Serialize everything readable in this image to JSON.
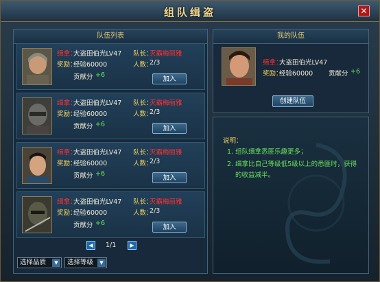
{
  "window": {
    "title": "组队缉盗",
    "close_label": "✕"
  },
  "team_list": {
    "header": "队伍列表",
    "rows": [
      {
        "wanted_label": "缉拿：",
        "wanted": "大盗田伯光LV47",
        "leader_label": "队长：",
        "leader": "灭霸梅丽雅",
        "reward_label": "奖励：",
        "reward": "经验60000",
        "members_label": "人数：",
        "members": "2/3",
        "contrib_label": "贡献分",
        "contrib": "+6",
        "join": "加入"
      },
      {
        "wanted_label": "缉拿：",
        "wanted": "大盗田伯光LV47",
        "leader_label": "队长：",
        "leader": "灭霸梅丽雅",
        "reward_label": "奖励：",
        "reward": "经验60000",
        "members_label": "人数：",
        "members": "2/3",
        "contrib_label": "贡献分",
        "contrib": "+6",
        "join": "加入"
      },
      {
        "wanted_label": "缉拿：",
        "wanted": "大盗田伯光LV47",
        "leader_label": "队长：",
        "leader": "灭霸梅丽雅",
        "reward_label": "奖励：",
        "reward": "经验60000",
        "members_label": "人数：",
        "members": "2/3",
        "contrib_label": "贡献分",
        "contrib": "+6",
        "join": "加入"
      },
      {
        "wanted_label": "缉拿：",
        "wanted": "大盗田伯光LV47",
        "leader_label": "队长：",
        "leader": "灭霸梅丽雅",
        "reward_label": "奖励：",
        "reward": "经验60000",
        "members_label": "人数：",
        "members": "2/3",
        "contrib_label": "贡献分",
        "contrib": "+6",
        "join": "加入"
      }
    ],
    "pagination": "1/1",
    "prev_icon": "◀",
    "next_icon": "▶",
    "quality_select": "选择品质",
    "level_select": "选择等级",
    "dropdown_icon": "▼"
  },
  "my_team": {
    "header": "我的队伍",
    "wanted_label": "缉拿：",
    "wanted": "大盗田伯光LV47",
    "reward_label": "奖励：",
    "reward": "经验60000",
    "contrib_label": "贡献分",
    "contrib": "+6",
    "create_button": "创建队伍"
  },
  "notes": {
    "title": "说明：",
    "line1": "1. 组队缉拿悉匪乐趣更多；",
    "line2a": "2. 缉拿比自己等级低5级以上的悉匪时，获得",
    "line2b": "的收益减半。"
  },
  "colors": {
    "accent": "#f2d060",
    "warning": "#ff3030",
    "bonus": "#6ae060"
  }
}
